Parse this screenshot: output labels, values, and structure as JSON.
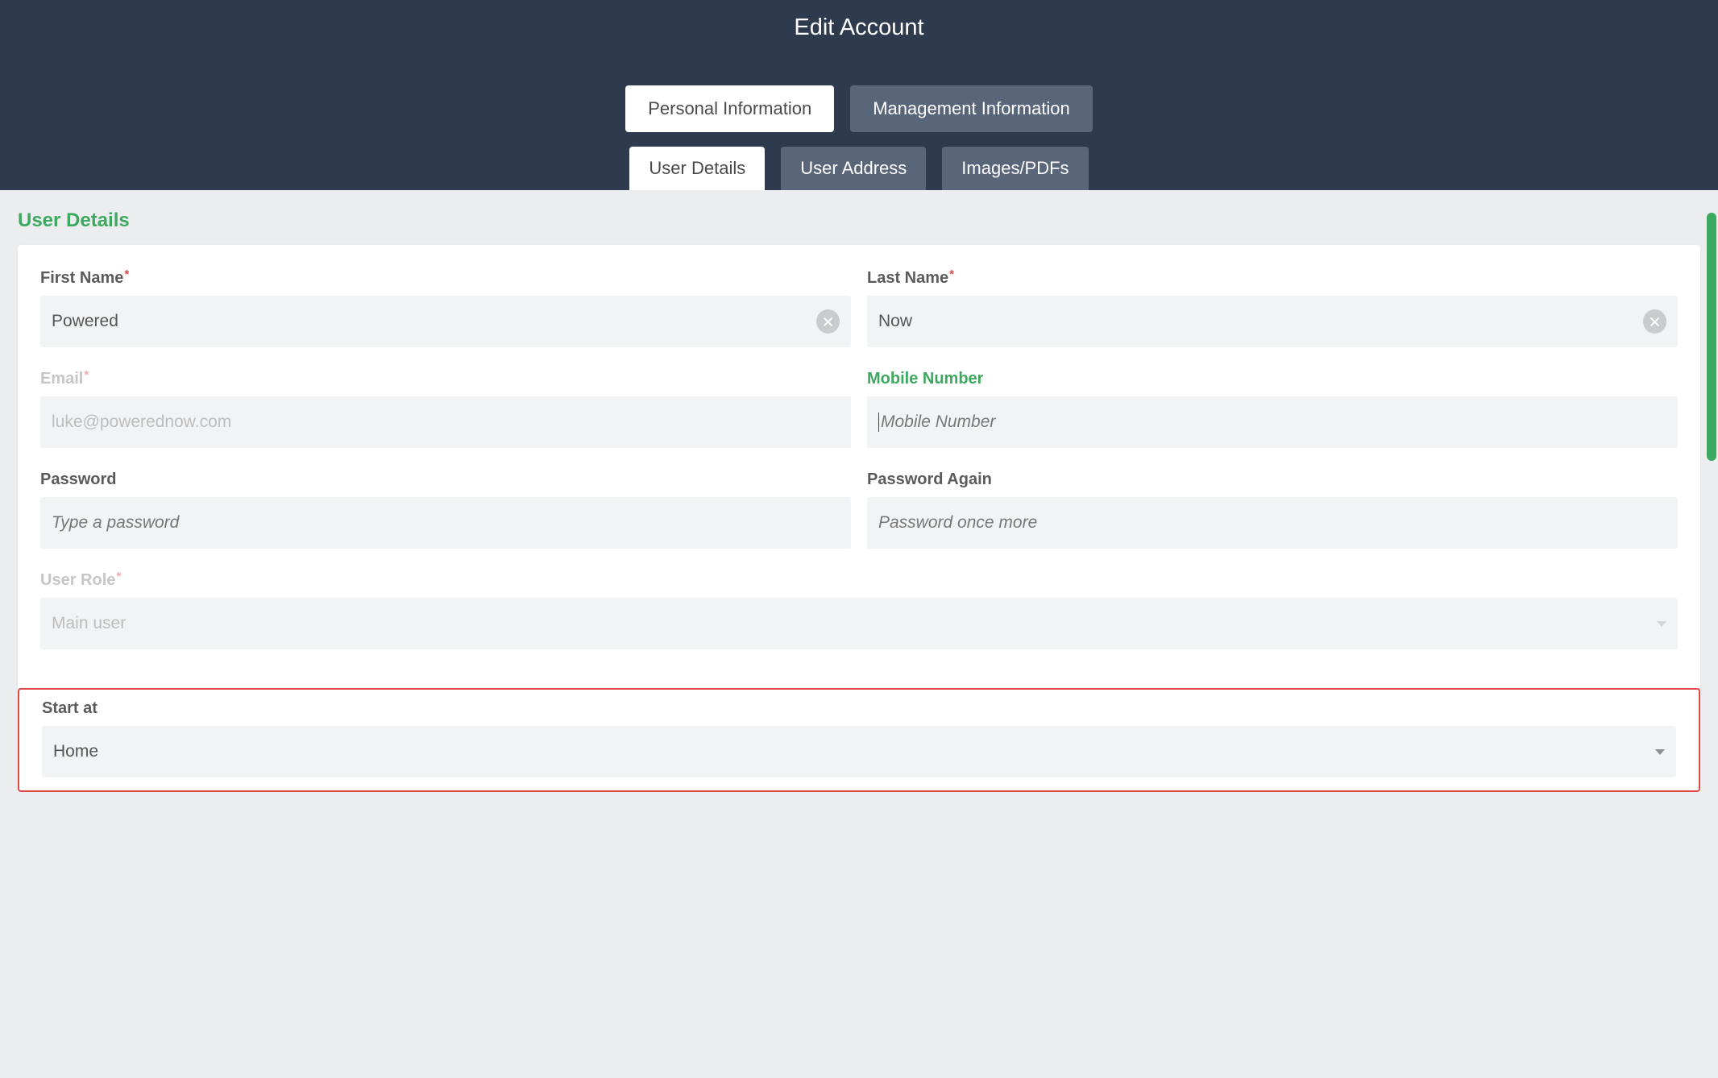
{
  "header": {
    "title": "Edit Account"
  },
  "tabs": {
    "primary": [
      {
        "label": "Personal Information",
        "active": true
      },
      {
        "label": "Management Information",
        "active": false
      }
    ],
    "secondary": [
      {
        "label": "User Details",
        "active": true
      },
      {
        "label": "User Address",
        "active": false
      },
      {
        "label": "Images/PDFs",
        "active": false
      }
    ]
  },
  "section": {
    "title": "User Details"
  },
  "form": {
    "first_name": {
      "label": "First Name",
      "value": "Powered"
    },
    "last_name": {
      "label": "Last Name",
      "value": "Now"
    },
    "email": {
      "label": "Email",
      "value": "luke@powerednow.com"
    },
    "mobile": {
      "label": "Mobile Number",
      "placeholder": "Mobile Number"
    },
    "password": {
      "label": "Password",
      "placeholder": "Type a password"
    },
    "password_again": {
      "label": "Password Again",
      "placeholder": "Password once more"
    },
    "user_role": {
      "label": "User Role",
      "value": "Main user"
    },
    "start_at": {
      "label": "Start at",
      "value": "Home"
    }
  }
}
